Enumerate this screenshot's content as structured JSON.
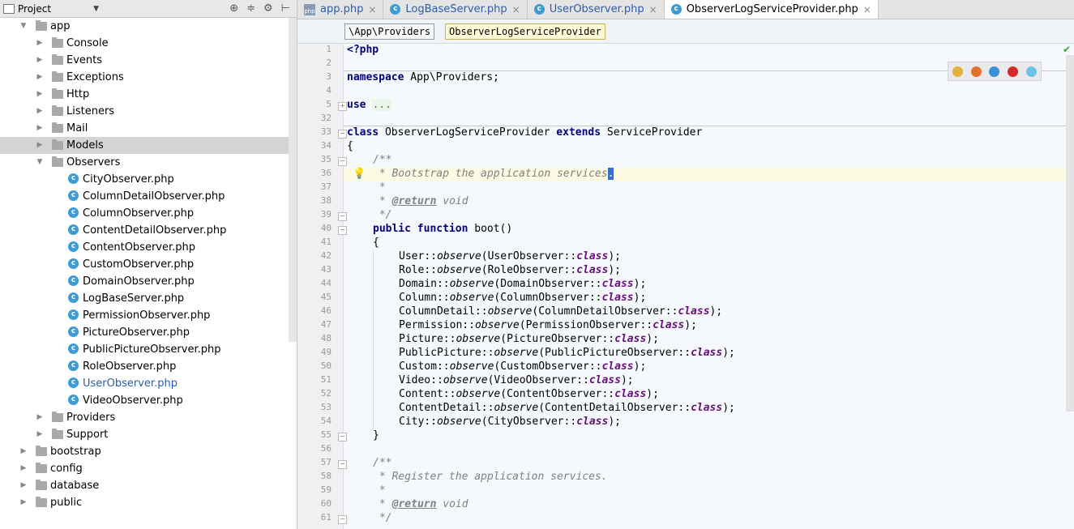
{
  "project_panel": {
    "title": "Project",
    "tree": [
      {
        "label": "app",
        "type": "folder",
        "depth": 1,
        "expanded": true
      },
      {
        "label": "Console",
        "type": "folder",
        "depth": 2,
        "expanded": false
      },
      {
        "label": "Events",
        "type": "folder",
        "depth": 2,
        "expanded": false
      },
      {
        "label": "Exceptions",
        "type": "folder",
        "depth": 2,
        "expanded": false
      },
      {
        "label": "Http",
        "type": "folder",
        "depth": 2,
        "expanded": false
      },
      {
        "label": "Listeners",
        "type": "folder",
        "depth": 2,
        "expanded": false
      },
      {
        "label": "Mail",
        "type": "folder",
        "depth": 2,
        "expanded": false
      },
      {
        "label": "Models",
        "type": "folder",
        "depth": 2,
        "expanded": false,
        "selected": true
      },
      {
        "label": "Observers",
        "type": "folder",
        "depth": 2,
        "expanded": true
      },
      {
        "label": "CityObserver.php",
        "type": "class",
        "depth": 3
      },
      {
        "label": "ColumnDetailObserver.php",
        "type": "class",
        "depth": 3
      },
      {
        "label": "ColumnObserver.php",
        "type": "class",
        "depth": 3
      },
      {
        "label": "ContentDetailObserver.php",
        "type": "class",
        "depth": 3
      },
      {
        "label": "ContentObserver.php",
        "type": "class",
        "depth": 3
      },
      {
        "label": "CustomObserver.php",
        "type": "class",
        "depth": 3
      },
      {
        "label": "DomainObserver.php",
        "type": "class",
        "depth": 3
      },
      {
        "label": "LogBaseServer.php",
        "type": "class",
        "depth": 3
      },
      {
        "label": "PermissionObserver.php",
        "type": "class",
        "depth": 3
      },
      {
        "label": "PictureObserver.php",
        "type": "class",
        "depth": 3
      },
      {
        "label": "PublicPictureObserver.php",
        "type": "class",
        "depth": 3
      },
      {
        "label": "RoleObserver.php",
        "type": "class",
        "depth": 3
      },
      {
        "label": "UserObserver.php",
        "type": "class",
        "depth": 3,
        "active": true
      },
      {
        "label": "VideoObserver.php",
        "type": "class",
        "depth": 3
      },
      {
        "label": "Providers",
        "type": "folder",
        "depth": 2,
        "expanded": false
      },
      {
        "label": "Support",
        "type": "folder",
        "depth": 2,
        "expanded": false
      },
      {
        "label": "bootstrap",
        "type": "folder",
        "depth": 1,
        "expanded": false
      },
      {
        "label": "config",
        "type": "folder",
        "depth": 1,
        "expanded": false
      },
      {
        "label": "database",
        "type": "folder",
        "depth": 1,
        "expanded": false
      },
      {
        "label": "public",
        "type": "folder",
        "depth": 1,
        "expanded": false
      }
    ]
  },
  "tabs": [
    {
      "label": "app.php",
      "icon": "php-file-icon"
    },
    {
      "label": "LogBaseServer.php",
      "icon": "class-icon"
    },
    {
      "label": "UserObserver.php",
      "icon": "class-icon"
    },
    {
      "label": "ObserverLogServiceProvider.php",
      "icon": "class-icon",
      "active": true
    }
  ],
  "breadcrumb": [
    "\\App\\Providers",
    "ObserverLogServiceProvider"
  ],
  "editor": {
    "line_numbers": [
      "1",
      "2",
      "3",
      "4",
      "5",
      "32",
      "33",
      "34",
      "35",
      "36",
      "37",
      "38",
      "39",
      "40",
      "41",
      "42",
      "43",
      "44",
      "45",
      "46",
      "47",
      "48",
      "49",
      "50",
      "51",
      "52",
      "53",
      "54",
      "55",
      "56",
      "57",
      "58",
      "59",
      "60",
      "61"
    ],
    "code": {
      "l1": "<?php",
      "l3_kw": "namespace",
      "l3_rest": " App\\Providers;",
      "l5_kw": "use",
      "l5_dots": "...",
      "l33_kw1": "class",
      "l33_name": " ObserverLogServiceProvider ",
      "l33_kw2": "extends",
      "l33_parent": " ServiceProvider",
      "open_brace": "{",
      "close_brace": "}",
      "doc_open": "/**",
      "doc_line1": " * Bootstrap the application services",
      "doc_line1_cursor": ".",
      "doc_star": " *",
      "doc_return_tag": "@return",
      "doc_return_type": " void",
      "doc_close": " */",
      "l40_kw1": "public",
      "l40_kw2": "function",
      "l40_rest": " boot()",
      "observers": [
        {
          "model": "User",
          "observer": "UserObserver"
        },
        {
          "model": "Role",
          "observer": "RoleObserver"
        },
        {
          "model": "Domain",
          "observer": "DomainObserver"
        },
        {
          "model": "Column",
          "observer": "ColumnObserver"
        },
        {
          "model": "ColumnDetail",
          "observer": "ColumnDetailObserver"
        },
        {
          "model": "Permission",
          "observer": "PermissionObserver"
        },
        {
          "model": "Picture",
          "observer": "PictureObserver"
        },
        {
          "model": "PublicPicture",
          "observer": "PublicPictureObserver"
        },
        {
          "model": "Custom",
          "observer": "CustomObserver"
        },
        {
          "model": "Video",
          "observer": "VideoObserver"
        },
        {
          "model": "Content",
          "observer": "ContentObserver"
        },
        {
          "model": "ContentDetail",
          "observer": "ContentDetailObserver"
        },
        {
          "model": "City",
          "observer": "CityObserver"
        }
      ],
      "observe_sep": "::",
      "observe_method": "observe",
      "class_kw": "class",
      "doc_line2": " * Register the application services."
    }
  },
  "browser_icons": [
    "chrome-icon",
    "firefox-icon",
    "safari-icon",
    "opera-icon",
    "ie-icon"
  ],
  "colors": {
    "selection": "#d4d4d4",
    "active_file": "#2a5db0",
    "class_icon": "#3d9bd6",
    "caret_line": "#fcfae3"
  }
}
